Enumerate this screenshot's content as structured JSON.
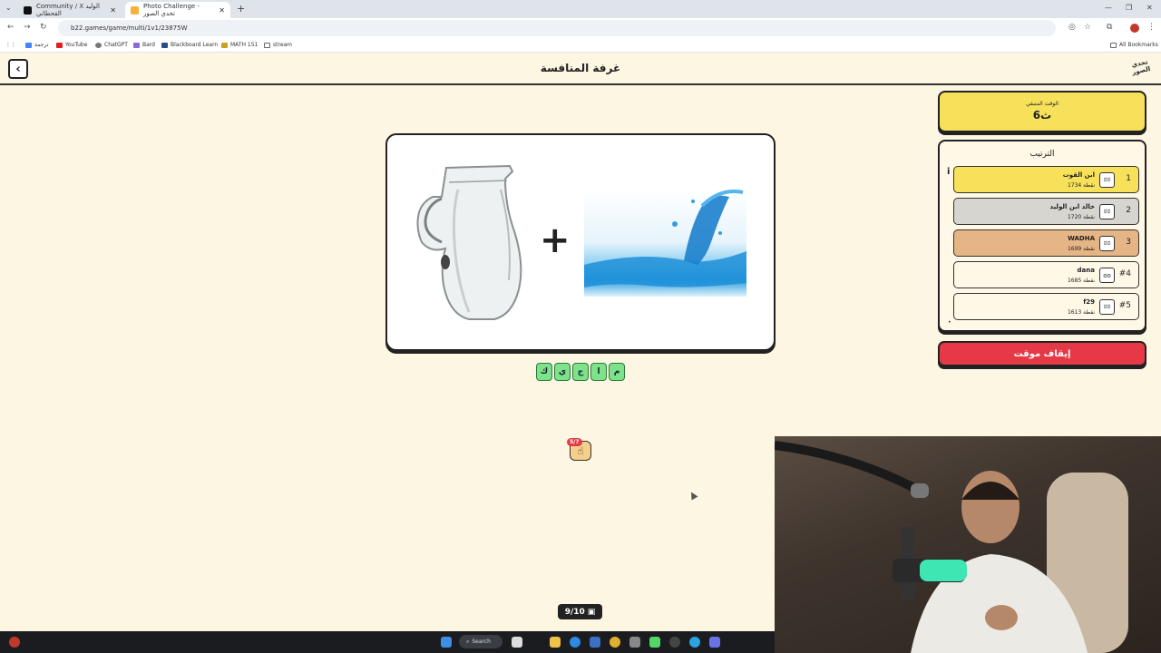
{
  "browser": {
    "tabs": [
      {
        "label": "Community / X الوليد القحطاني",
        "active": false
      },
      {
        "label": "Photo Challenge - تحدي الصور",
        "active": true
      }
    ],
    "url": "b22.games/game/multi/1v1/23875W",
    "bookmarks": [
      "ترجمة",
      "YouTube",
      "ChatGPT",
      "Bard",
      "Blackboard Learn",
      "MATH 151",
      "stream"
    ],
    "all_bookmarks": "All Bookmarks"
  },
  "header": {
    "title": "غرفة المنافسة",
    "logo": "تحدي الصور"
  },
  "puzzle": {
    "images": [
      "glass-jug",
      "water-splash"
    ],
    "operator": "+"
  },
  "answer": {
    "letters": [
      "م",
      "ا",
      "ج",
      "ي",
      "ك"
    ]
  },
  "hint": {
    "badge": "5/7"
  },
  "progress": {
    "label": "9/10"
  },
  "timer": {
    "label": "الوقت المتبقي",
    "value": "6ث"
  },
  "ranking": {
    "title": "الترتيب",
    "players": [
      {
        "rank": "1",
        "name": "ابن القوت",
        "score": "1734 نقطة",
        "color": "#f7e15b",
        "avatar": "ಠಠ"
      },
      {
        "rank": "2",
        "name": "خالد ابن الوليد",
        "score": "1720 نقطة",
        "color": "#d7d5cf",
        "avatar": "ಠಠ"
      },
      {
        "rank": "3",
        "name": "WADHA",
        "score": "1699 نقطة",
        "color": "#e6b586",
        "avatar": "ಠಠ"
      },
      {
        "rank": "#4",
        "name": "dana",
        "score": "1685 نقطة",
        "color": "#fff8e6",
        "avatar": "oo"
      },
      {
        "rank": "#5",
        "name": "f29",
        "score": "1613 نقطة",
        "color": "#fff8e6",
        "avatar": "ಠಠ"
      }
    ]
  },
  "stop_button": {
    "label": "إيقاف موقت"
  },
  "taskbar": {
    "search": "Search"
  },
  "colors": {
    "background": "#fdf6e3",
    "timer": "#f7e15b",
    "stop": "#e53946",
    "tile": "#7ee28a"
  }
}
